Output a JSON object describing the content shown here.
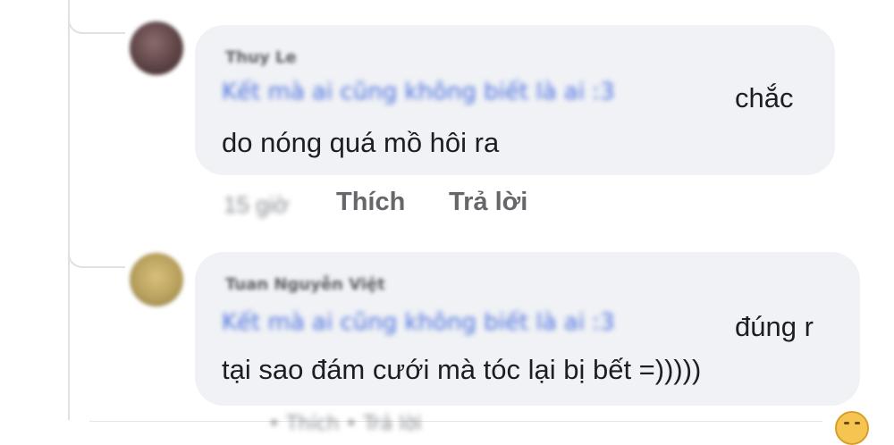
{
  "comments": [
    {
      "author": "Thuy Le",
      "quote": "Kết mà ai cũng không biết là ai :3",
      "text_line1": "chắc",
      "text_line2": "do nóng quá mồ hôi ra",
      "time": "15 giờ",
      "like_label": "Thích",
      "reply_label": "Trả lời"
    },
    {
      "author": "Tuan Nguyễn Việt",
      "quote": "Kết mà ai cũng không biết là ai :3",
      "text_line1": "đúng r",
      "text_line2": "tại sao đám cưới mà tóc lại bị bết =)))))"
    }
  ],
  "next_actions_blur": "• Thích • Trả lời"
}
